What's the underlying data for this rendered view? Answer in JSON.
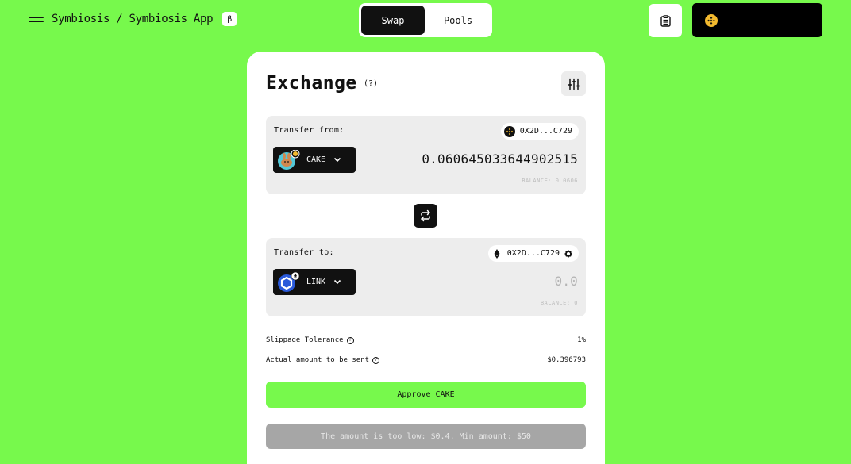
{
  "header": {
    "brand_title": "Symbiosis / Symbiosis App",
    "beta_badge": "β",
    "tabs": [
      {
        "label": "Swap",
        "active": true
      },
      {
        "label": "Pools",
        "active": false
      }
    ],
    "history_icon": "clipboard-icon",
    "wallet_icon": "bnb-chain-icon"
  },
  "exchange": {
    "title": "Exchange",
    "help": "(?)",
    "settings_icon": "sliders-icon",
    "from": {
      "label": "Transfer from:",
      "chain_icon": "bnb-chain-icon",
      "address": "0X2D...C729",
      "token": "CAKE",
      "token_icon": "pancakeswap-cake-icon",
      "amount": "0.060645033644902515",
      "balance": "BALANCE: 0.0606"
    },
    "swap_icon": "swap-arrows-icon",
    "to": {
      "label": "Transfer to:",
      "chain_icon": "ethereum-icon",
      "address": "0X2D...C729",
      "settings_icon": "gear-icon",
      "token": "LINK",
      "token_icon": "chainlink-icon",
      "amount_placeholder": "0.0",
      "balance": "BALANCE: 0"
    },
    "slippage": {
      "label": "Slippage Tolerance",
      "value": "1%"
    },
    "actual_amount": {
      "label": "Actual amount to be sent",
      "value": "$0.396793"
    },
    "approve_label": "Approve CAKE",
    "warning_label": "The amount is too low: $0.4. Min amount: $50"
  },
  "colors": {
    "background": "#77f94c",
    "accent": "#77f94c",
    "dark": "#111111",
    "panel": "#ededed",
    "disabled": "#a6a6a6"
  }
}
